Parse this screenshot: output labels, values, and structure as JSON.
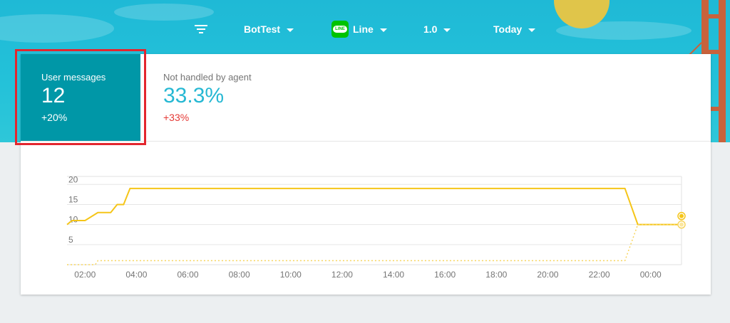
{
  "topbar": {
    "filter_icon": "filter-icon",
    "bot": "BotTest",
    "channel": "Line",
    "channel_logo_text": "LINE",
    "version": "1.0",
    "period": "Today"
  },
  "stats": {
    "user_messages": {
      "label": "User messages",
      "value": "12",
      "delta": "+20%"
    },
    "not_handled": {
      "label": "Not handled by agent",
      "value": "33.3%",
      "delta": "+33%"
    }
  },
  "colors": {
    "header_bg": "#23c1d9",
    "selected_stat_bg": "#0097a7",
    "accent": "#26b8d3",
    "negative": "#e53935",
    "series_line": "#f5c518",
    "highlight_box": "#e3262e"
  },
  "chart_data": {
    "type": "line",
    "x_ticks": [
      "02:00",
      "04:00",
      "06:00",
      "08:00",
      "10:00",
      "12:00",
      "14:00",
      "16:00",
      "18:00",
      "20:00",
      "22:00",
      "00:00"
    ],
    "y_ticks": [
      5,
      10,
      15,
      20
    ],
    "ylim": [
      0,
      22
    ],
    "xlim": [
      1.3,
      25.2
    ],
    "grid": true,
    "series": [
      {
        "style": "solid",
        "x": [
          1.3,
          1.5,
          2.0,
          2.5,
          3.0,
          3.25,
          3.5,
          3.75,
          4.0,
          23.0,
          23.5,
          25.2
        ],
        "y": [
          10,
          11,
          11,
          13,
          13,
          15,
          15,
          19,
          19,
          19,
          10,
          10
        ]
      },
      {
        "style": "dotted",
        "x": [
          1.3,
          2.4,
          2.5,
          23.0,
          23.5,
          25.2
        ],
        "y": [
          0,
          0,
          1,
          1,
          10,
          10
        ]
      }
    ]
  }
}
